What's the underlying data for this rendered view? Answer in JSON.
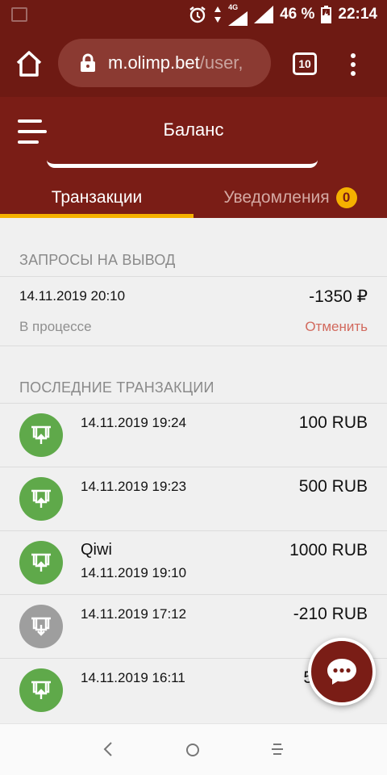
{
  "status_bar": {
    "battery": "46 %",
    "time": "22:14",
    "network": "4G"
  },
  "browser": {
    "url_host": "m.olimp.bet",
    "url_path": "/user,",
    "tab_count": "10"
  },
  "header": {
    "title": "Баланс"
  },
  "tabs": [
    {
      "label": "Транзакции",
      "active": true
    },
    {
      "label": "Уведомления",
      "badge": "0",
      "active": false
    }
  ],
  "withdraw_requests": {
    "title": "ЗАПРОСЫ НА ВЫВОД",
    "items": [
      {
        "date": "14.11.2019 20:10",
        "amount": "-1350 ₽",
        "status": "В процессе",
        "action": "Отменить"
      }
    ]
  },
  "recent": {
    "title": "ПОСЛЕДНИЕ ТРАНЗАКЦИИ",
    "items": [
      {
        "method": "",
        "date": "14.11.2019 19:24",
        "amount": "100 RUB",
        "type": "deposit"
      },
      {
        "method": "",
        "date": "14.11.2019 19:23",
        "amount": "500 RUB",
        "type": "deposit"
      },
      {
        "method": "Qiwi",
        "date": "14.11.2019 19:10",
        "amount": "1000 RUB",
        "type": "deposit"
      },
      {
        "method": "",
        "date": "14.11.2019 17:12",
        "amount": "-210 RUB",
        "type": "withdraw"
      },
      {
        "method": "",
        "date": "14.11.2019 16:11",
        "amount": "5",
        "type": "deposit"
      }
    ]
  },
  "colors": {
    "brand": "#7a1d16",
    "accent": "#f5b100",
    "deposit": "#5fa94a",
    "withdraw": "#9e9e9e",
    "cancel": "#d26a5e"
  }
}
